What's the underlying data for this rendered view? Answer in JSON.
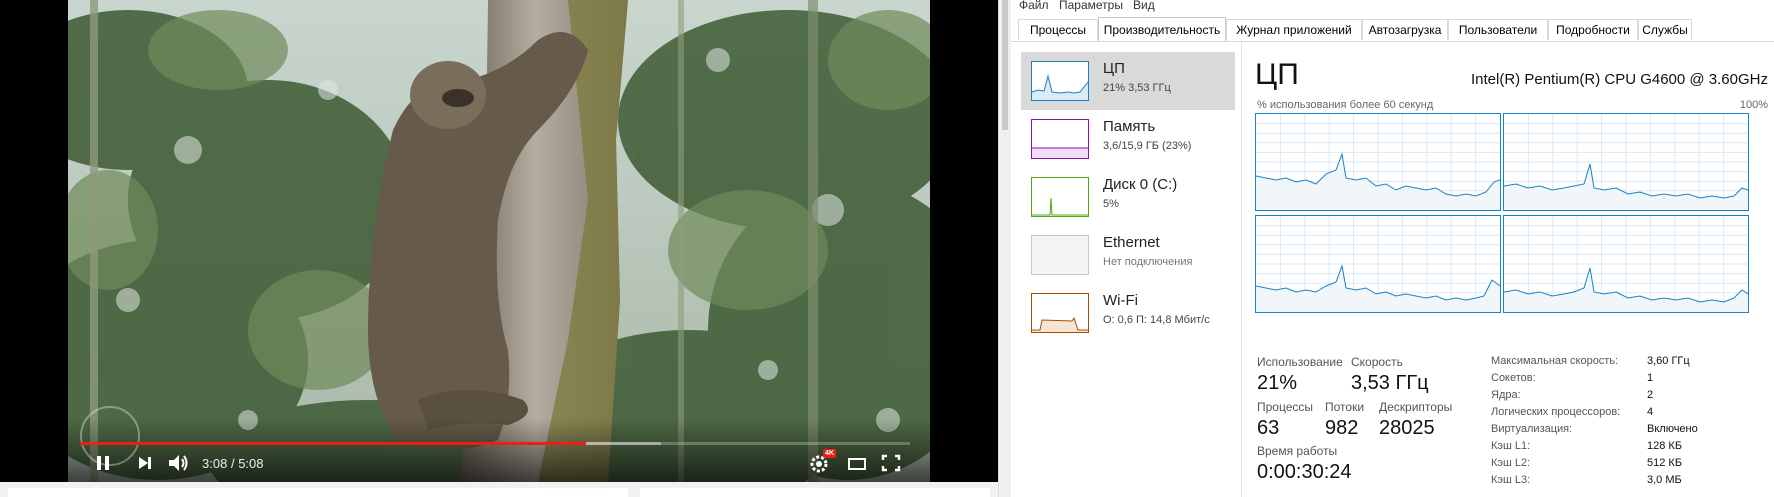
{
  "video": {
    "current_time": "3:08",
    "separator": "/",
    "duration": "5:08",
    "played_fraction": 0.61,
    "buffered_fraction": 0.7,
    "hd_badge": "4K",
    "accent_color": "#e62117"
  },
  "taskmanager": {
    "menu": [
      "Файл",
      "Параметры",
      "Вид"
    ],
    "tabs": [
      "Процессы",
      "Производительность",
      "Журнал приложений",
      "Автозагрузка",
      "Пользователи",
      "Подробности",
      "Службы"
    ],
    "active_tab": "Производительность",
    "sidebar": [
      {
        "title": "ЦП",
        "subtitle": "21% 3,53 ГГц",
        "color": "#1782c4"
      },
      {
        "title": "Память",
        "subtitle": "3,6/15,9 ГБ (23%)",
        "color": "#8b12ae"
      },
      {
        "title": "Диск 0 (C:)",
        "subtitle": "5%",
        "color": "#4da60c"
      },
      {
        "title": "Ethernet",
        "subtitle": "Нет подключения",
        "color": "#a7a7a7"
      },
      {
        "title": "Wi-Fi",
        "subtitle": "О: 0,6 П: 14,8 Мбит/с",
        "color": "#a74f01"
      }
    ],
    "cpu": {
      "title": "ЦП",
      "model": "Intel(R) Pentium(R) CPU G4600 @ 3.60GHz",
      "graph_label": "% использования более 60 секунд",
      "graph_max": "100%",
      "stats": {
        "usage_label": "Использование",
        "usage": "21%",
        "speed_label": "Скорость",
        "speed": "3,53 ГГц",
        "processes_label": "Процессы",
        "processes": "63",
        "threads_label": "Потоки",
        "threads": "982",
        "handles_label": "Дескрипторы",
        "handles": "28025",
        "uptime_label": "Время работы",
        "uptime": "0:00:30:24"
      },
      "details": [
        {
          "label": "Максимальная скорость:",
          "value": "3,60 ГГц"
        },
        {
          "label": "Сокетов:",
          "value": "1"
        },
        {
          "label": "Ядра:",
          "value": "2"
        },
        {
          "label": "Логических процессоров:",
          "value": "4"
        },
        {
          "label": "Виртуализация:",
          "value": "Включено"
        },
        {
          "label": "Кэш L1:",
          "value": "128 КБ"
        },
        {
          "label": "Кэш L2:",
          "value": "512 КБ"
        },
        {
          "label": "Кэш L3:",
          "value": "3,0 МБ"
        }
      ]
    }
  }
}
